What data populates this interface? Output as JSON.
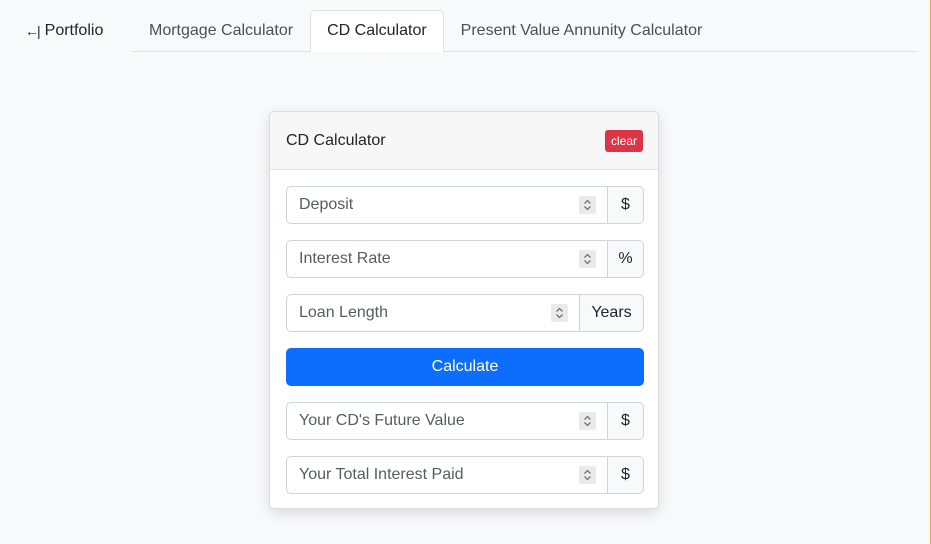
{
  "nav": {
    "back_icon": "←|",
    "portfolio_label": "Portfolio"
  },
  "tabs": [
    {
      "label": "Mortgage Calculator",
      "active": false
    },
    {
      "label": "CD Calculator",
      "active": true
    },
    {
      "label": "Present Value Annunity Calculator",
      "active": false
    }
  ],
  "card": {
    "title": "CD Calculator",
    "clear_label": "clear",
    "fields": {
      "deposit": {
        "placeholder": "Deposit",
        "value": "",
        "unit": "$"
      },
      "interest_rate": {
        "placeholder": "Interest Rate",
        "value": "",
        "unit": "%"
      },
      "loan_length": {
        "placeholder": "Loan Length",
        "value": "",
        "unit": "Years"
      },
      "future_value": {
        "placeholder": "Your CD's Future Value",
        "value": "",
        "unit": "$"
      },
      "total_interest": {
        "placeholder": "Your Total Interest Paid",
        "value": "",
        "unit": "$"
      }
    },
    "calculate_label": "Calculate"
  },
  "colors": {
    "primary": "#0d6efd",
    "danger": "#dc3545",
    "right_rule": "#f0a646"
  },
  "icons": {
    "back": "back-arrow-icon",
    "spinner": "spinner-arrows-icon"
  }
}
